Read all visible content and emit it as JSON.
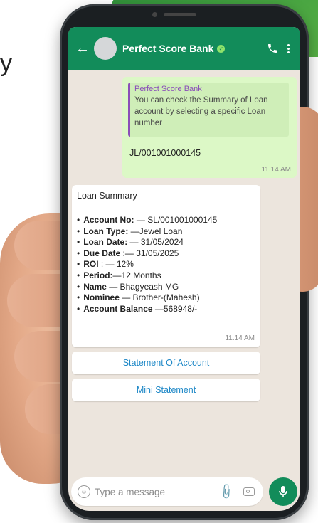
{
  "background_text": "y",
  "header": {
    "title": "Perfect Score Bank",
    "back_icon": "arrow-left-icon",
    "verified_icon": "verified-badge-icon",
    "call_icon": "phone-icon",
    "menu_icon": "more-vertical-icon",
    "color": "#128c5a"
  },
  "outgoing": {
    "quote_title": "Perfect Score Bank",
    "quote_text": "You can check the Summary of Loan account by selecting a specific Loan number",
    "text": "JL/001001000145",
    "time": "11.14 AM"
  },
  "incoming": {
    "title": "Loan Summary",
    "items": [
      {
        "label": "Account No:",
        "value": " — SL/001001000145"
      },
      {
        "label": "Loan Type:",
        "value": " —Jewel Loan"
      },
      {
        "label": "Loan Date:",
        "value": " — 31/05/2024"
      },
      {
        "label": "Due Date",
        "value": " :— 31/05/2025"
      },
      {
        "label": "ROI",
        "value": " : — 12%"
      },
      {
        "label": "Period:",
        "value": "—12 Months"
      },
      {
        "label": "Name",
        "value": "  — Bhagyeash MG"
      },
      {
        "label": "Nominee",
        "value": " — Brother-(Mahesh)"
      },
      {
        "label": "Account Balance",
        "value": " —568948/-"
      }
    ],
    "time": "11.14 AM"
  },
  "buttons": {
    "statement": "Statement Of Account",
    "mini": "Mini Statement"
  },
  "input": {
    "placeholder": "Type a message",
    "emoji_icon": "emoji-icon",
    "attach_icon": "paperclip-icon",
    "camera_icon": "camera-icon",
    "mic_icon": "mic-icon"
  }
}
